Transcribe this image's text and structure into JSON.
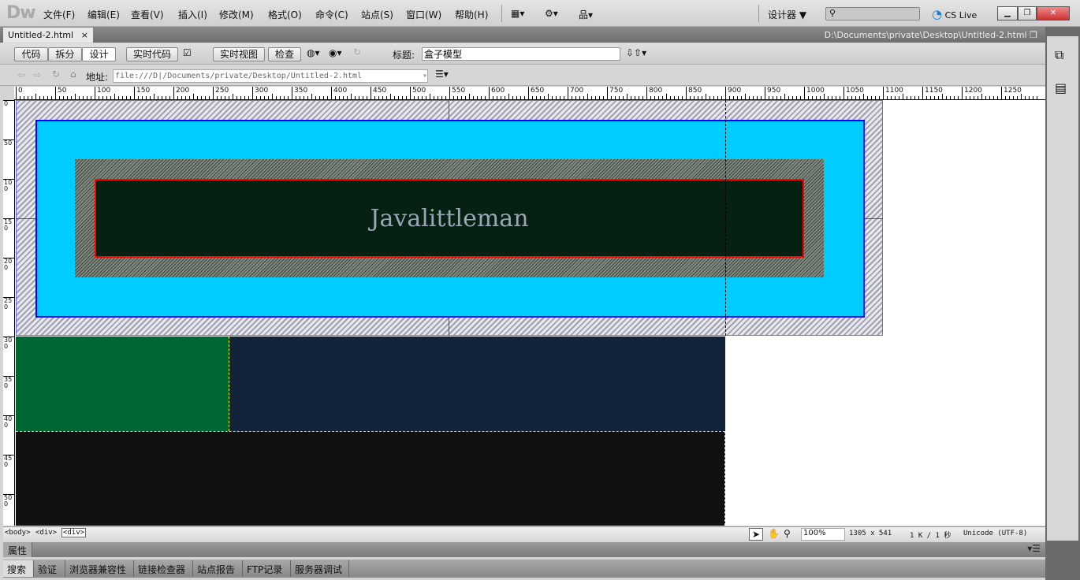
{
  "app": {
    "logo": "Dw",
    "menus": [
      "文件(F)",
      "编辑(E)",
      "查看(V)",
      "插入(I)",
      "修改(M)",
      "格式(O)",
      "命令(C)",
      "站点(S)",
      "窗口(W)",
      "帮助(H)"
    ],
    "workspace": "设计器 ▼",
    "cs_live": "CS Live",
    "search_placeholder": ""
  },
  "document": {
    "tab": "Untitled-2.html",
    "path": "D:\\Documents\\private\\Desktop\\Untitled-2.html"
  },
  "toolbar": {
    "code": "代码",
    "split": "拆分",
    "design": "设计",
    "live_code": "实时代码",
    "live_view": "实时视图",
    "inspect": "检查",
    "title_label": "标题:",
    "title_value": "盒子模型"
  },
  "address": {
    "label": "地址:",
    "value": "file:///D|/Documents/private/Desktop/Untitled-2.html"
  },
  "ruler": {
    "top": [
      "0",
      "50",
      "100",
      "150",
      "200",
      "250",
      "300",
      "350",
      "400",
      "450",
      "500",
      "550",
      "600",
      "650",
      "700",
      "750",
      "800",
      "850",
      "900",
      "950",
      "1000",
      "1050",
      "1100",
      "1150",
      "1200",
      "1250"
    ],
    "left": [
      "0",
      "50",
      "100",
      "150",
      "200",
      "250",
      "300",
      "350",
      "400",
      "450",
      "500"
    ]
  },
  "canvas": {
    "text": "Javalittleman",
    "colors": {
      "margin": "#e8e8f4",
      "border": "#0000ff",
      "cyan": "#00ccff",
      "content": "#062012",
      "content_border": "#ff0000",
      "green": "#006633",
      "navy": "#12233a",
      "black": "#111111"
    }
  },
  "status": {
    "tags": [
      "<body>",
      "<div>",
      "<div>"
    ],
    "zoom": "100%",
    "size": "1305 x 541",
    "weight": "1 K / 1 秒",
    "encoding": "Unicode (UTF-8)"
  },
  "panels": {
    "properties": "属性",
    "tabs": [
      "搜索",
      "验证",
      "浏览器兼容性",
      "链接检查器",
      "站点报告",
      "FTP记录",
      "服务器调试"
    ]
  }
}
